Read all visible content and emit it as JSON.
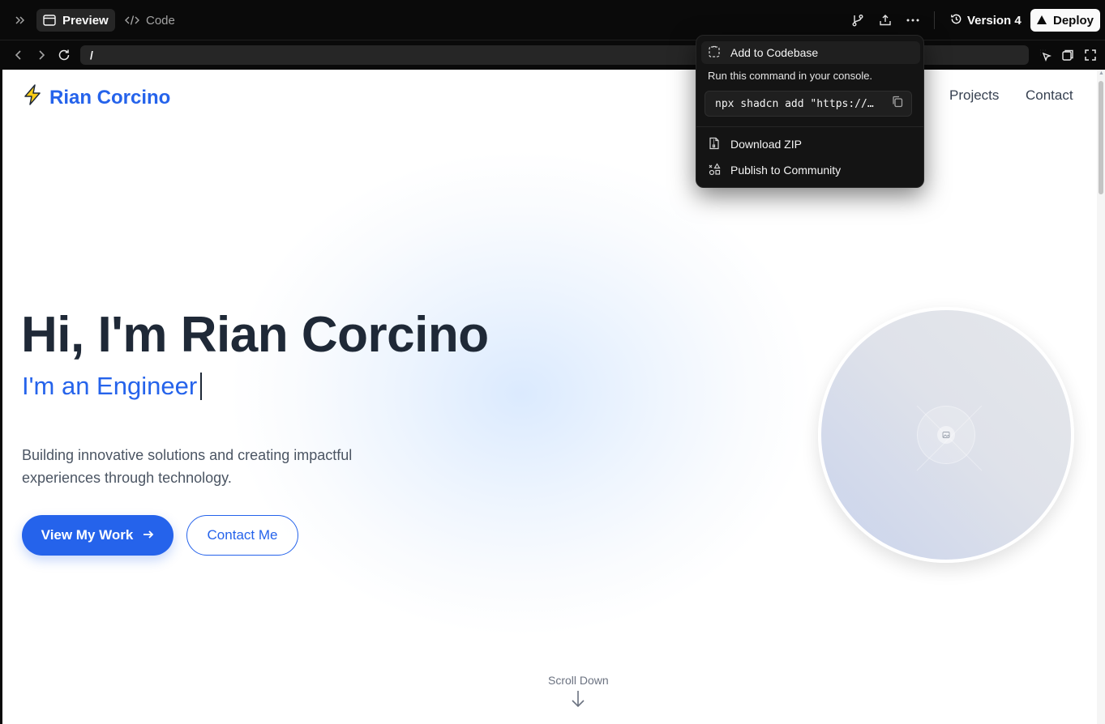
{
  "toolbar": {
    "preview_label": "Preview",
    "code_label": "Code",
    "version_label": "Version 4",
    "deploy_label": "Deploy"
  },
  "browser": {
    "url": "/"
  },
  "site": {
    "brand": "Rian Corcino",
    "nav": [
      "Projects",
      "Contact"
    ],
    "hero_title": "Hi, I'm Rian Corcino",
    "hero_subtitle": "I'm an Engineer",
    "hero_description": "Building innovative solutions and creating impactful experiences through technology.",
    "primary_button": "View My Work",
    "secondary_button": "Contact Me",
    "scroll_label": "Scroll Down"
  },
  "dropdown": {
    "add_to_codebase": "Add to Codebase",
    "caption": "Run this command in your console.",
    "command": "npx shadcn add \"https://…",
    "download_zip": "Download ZIP",
    "publish": "Publish to Community"
  },
  "colors": {
    "accent": "#2563eb",
    "heading": "#1f2937",
    "chrome_bg": "#0a0a0a"
  },
  "icons": [
    "sidebar-toggle-icon",
    "preview-icon",
    "code-icon",
    "branch-icon",
    "share-icon",
    "more-icon",
    "history-icon",
    "deploy-triangle-icon",
    "back-icon",
    "forward-icon",
    "refresh-icon",
    "select-element-icon",
    "open-new-window-icon",
    "fullscreen-icon",
    "lightning-icon",
    "arrow-right-icon",
    "image-placeholder-icon",
    "arrow-down-icon",
    "codebase-icon",
    "copy-icon",
    "file-zip-icon",
    "community-icon"
  ]
}
